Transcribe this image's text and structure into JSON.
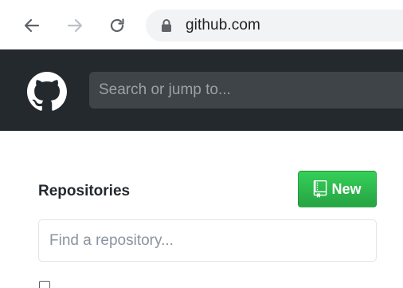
{
  "browser": {
    "url": "github.com",
    "icons": {
      "back": "arrow-left-icon",
      "forward": "arrow-right-icon",
      "reload": "reload-icon",
      "lock": "lock-icon"
    }
  },
  "header": {
    "logo": "github-mark-icon",
    "search_placeholder": "Search or jump to..."
  },
  "repositories": {
    "title": "Repositories",
    "new_label": "New",
    "new_icon": "repo-book-icon",
    "find_placeholder": "Find a repository..."
  },
  "colors": {
    "header_bg": "#24292e",
    "new_button": "#28a745",
    "omnibox_bg": "#f1f3f4"
  }
}
